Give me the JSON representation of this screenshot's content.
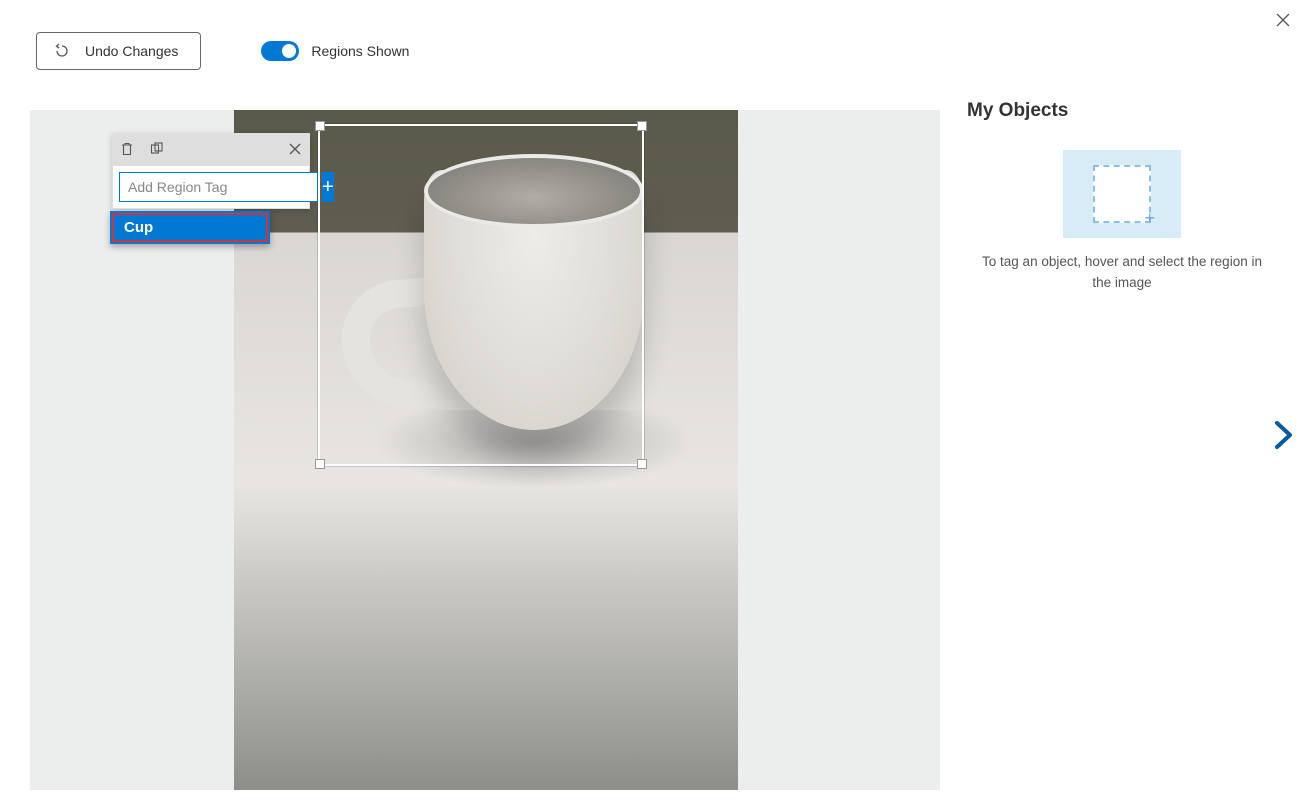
{
  "toolbar": {
    "undo_label": "Undo Changes",
    "toggle_label": "Regions Shown"
  },
  "tag_popup": {
    "input_placeholder": "Add Region Tag",
    "add_label": "+",
    "suggestion": "Cup"
  },
  "sidebar": {
    "title": "My Objects",
    "hint": "To tag an object, hover and select the region in the image"
  }
}
